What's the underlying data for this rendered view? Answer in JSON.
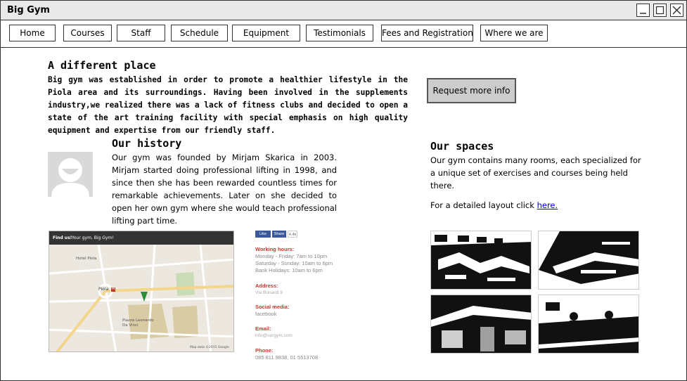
{
  "window": {
    "title": "Big Gym"
  },
  "nav": [
    "Home",
    "Courses",
    "Staff",
    "Schedule",
    "Equipment",
    "Testimonials",
    "Fees and Registration",
    "Where we are"
  ],
  "intro": {
    "heading": "A different place",
    "text": "Big gym was established in order to promote a healthier lifestyle in the Piola area and its surroundings.  Having  been involved  in the supplements industry,we realized there was  a lack  of fitness  clubs and decided to  open a state of the art training facility with special emphasis on high quality equipment and expertise from  our friendly staff."
  },
  "request_button": "Request more info",
  "history": {
    "heading": "Our history",
    "text": "Our gym was founded by Mirjam Skarica in 2003. Mirjam started doing professional lifting in 1998,  and since then she has been rewarded  countless  times  for  remarkable achievements. Later on she decided to open her own  gym where she would teach professional lifting part time."
  },
  "spaces": {
    "heading": "Our spaces",
    "text": "Our gym contains many rooms, each specialized for a unique set of exercises and courses being held there.",
    "layout_prefix": "For a detailed layout click ",
    "layout_link": "here."
  },
  "map": {
    "find_us": "Find us!",
    "place_name": "Your gym, Big Gym!",
    "labels": {
      "hotel": "Hotel Piola",
      "piola": "Piola",
      "metro": "M",
      "piazza": "Piazza Leonardo Da Vinci",
      "attribution": "Map data ©2015 Google"
    }
  },
  "contact": {
    "like": "Like",
    "share": "Share",
    "count": "4.4k",
    "hours_label": "Working hours:",
    "hours": [
      "Monday - Friday: 7am to 10pm",
      "Saturday - Sunday: 10am to 6pm",
      "Bank Holidays: 10am to 6pm"
    ],
    "address_label": "Address:",
    "address": "Via Bonardi 9",
    "social_label": "Social media:",
    "social": "facebook",
    "email_label": "Email:",
    "email": "info@ourgym.com",
    "phone_label": "Phone:",
    "phone": "085 811 9838, 01 5513708"
  },
  "icons": {
    "minimize": "minimize-icon",
    "maximize": "maximize-icon",
    "close": "close-icon"
  }
}
